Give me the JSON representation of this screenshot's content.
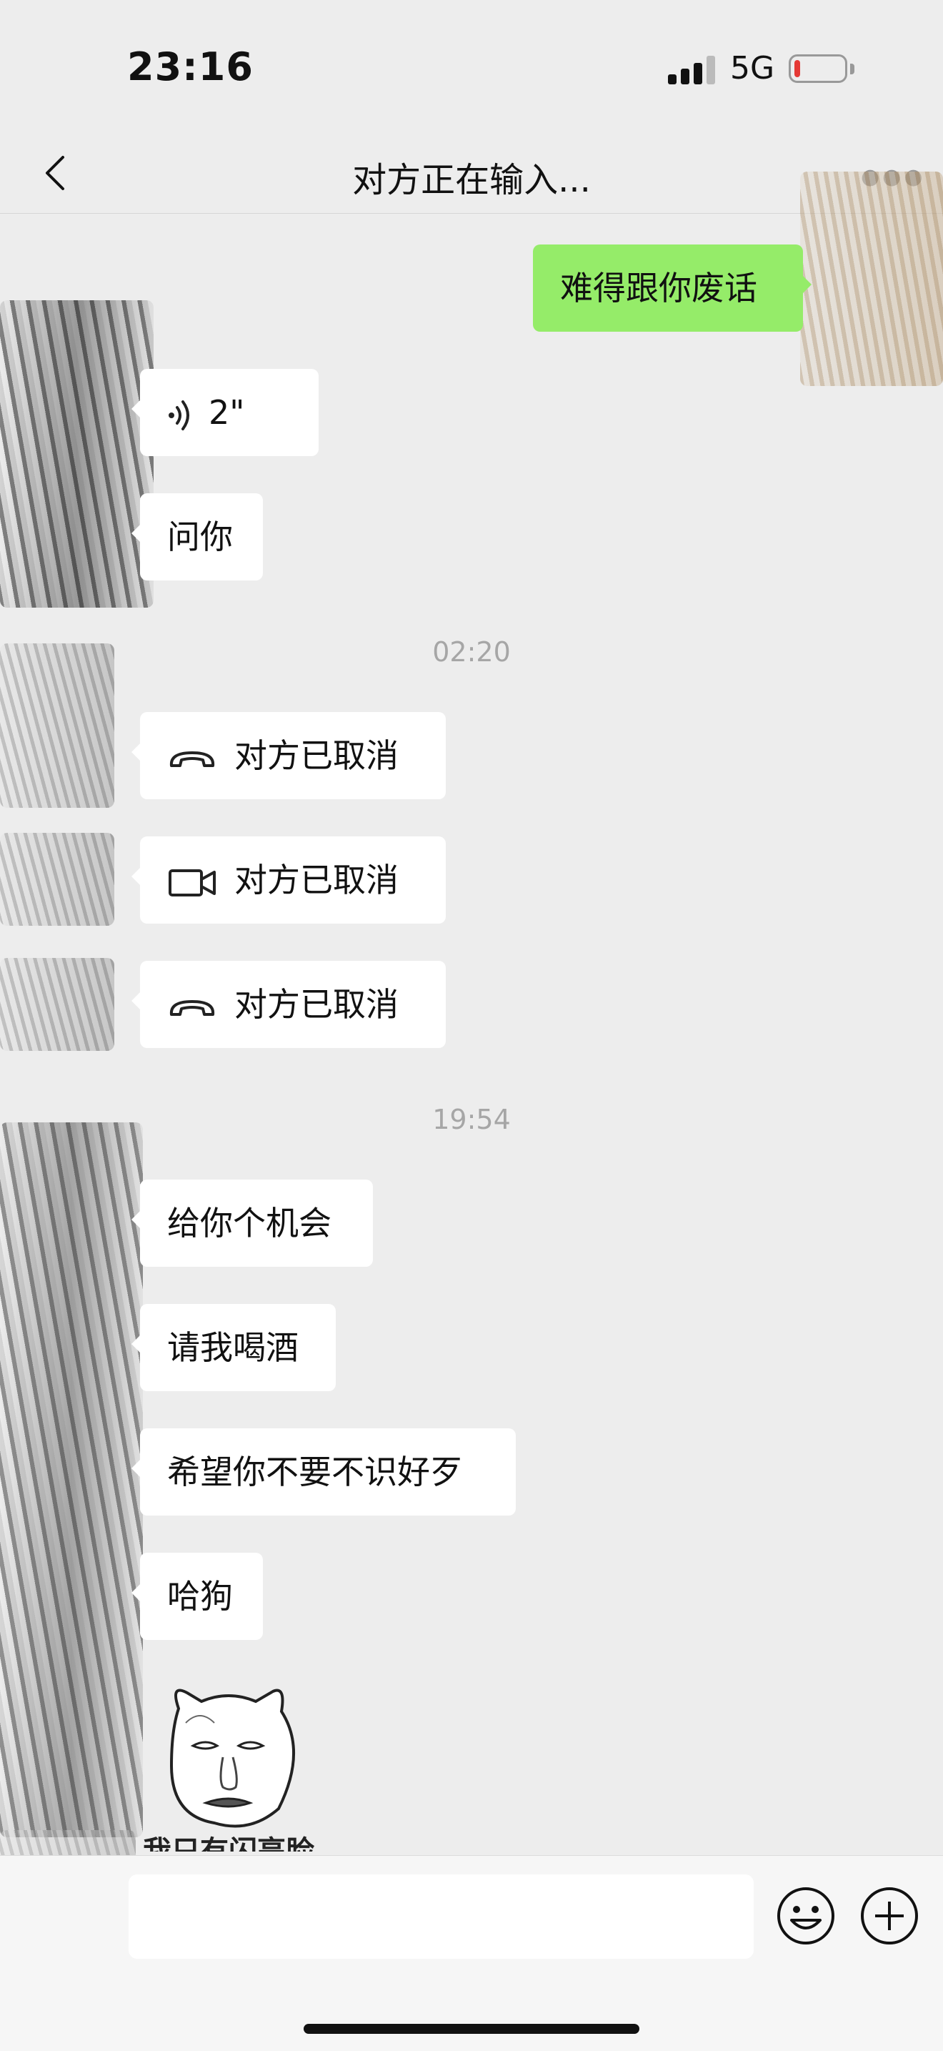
{
  "status_bar": {
    "time": "23:16",
    "network": "5G",
    "battery_level": 0.12
  },
  "header": {
    "title": "对方正在输入..."
  },
  "messages": [
    {
      "kind": "text",
      "sender": "self",
      "text": "难得跟你废话"
    },
    {
      "kind": "voice",
      "sender": "other",
      "duration": "2\""
    },
    {
      "kind": "text",
      "sender": "other",
      "text": "问你"
    },
    {
      "kind": "time",
      "text": "02:20"
    },
    {
      "kind": "call",
      "sender": "other",
      "call_type": "voice",
      "text": "对方已取消"
    },
    {
      "kind": "call",
      "sender": "other",
      "call_type": "video",
      "text": "对方已取消"
    },
    {
      "kind": "call",
      "sender": "other",
      "call_type": "voice",
      "text": "对方已取消"
    },
    {
      "kind": "time",
      "text": "19:54"
    },
    {
      "kind": "text",
      "sender": "other",
      "text": "给你个机会"
    },
    {
      "kind": "text",
      "sender": "other",
      "text": "请我喝酒"
    },
    {
      "kind": "text",
      "sender": "other",
      "text": "希望你不要不识好歹"
    },
    {
      "kind": "text",
      "sender": "other",
      "text": "哈狗"
    },
    {
      "kind": "sticker",
      "sender": "other",
      "caption": "我只有闪亮脸"
    }
  ],
  "input_bar": {
    "value": "",
    "emoji_icon": "smiley-icon",
    "plus_icon": "plus-icon"
  },
  "colors": {
    "self_bubble": "#95ec69",
    "other_bubble": "#ffffff",
    "background": "#ededed"
  }
}
